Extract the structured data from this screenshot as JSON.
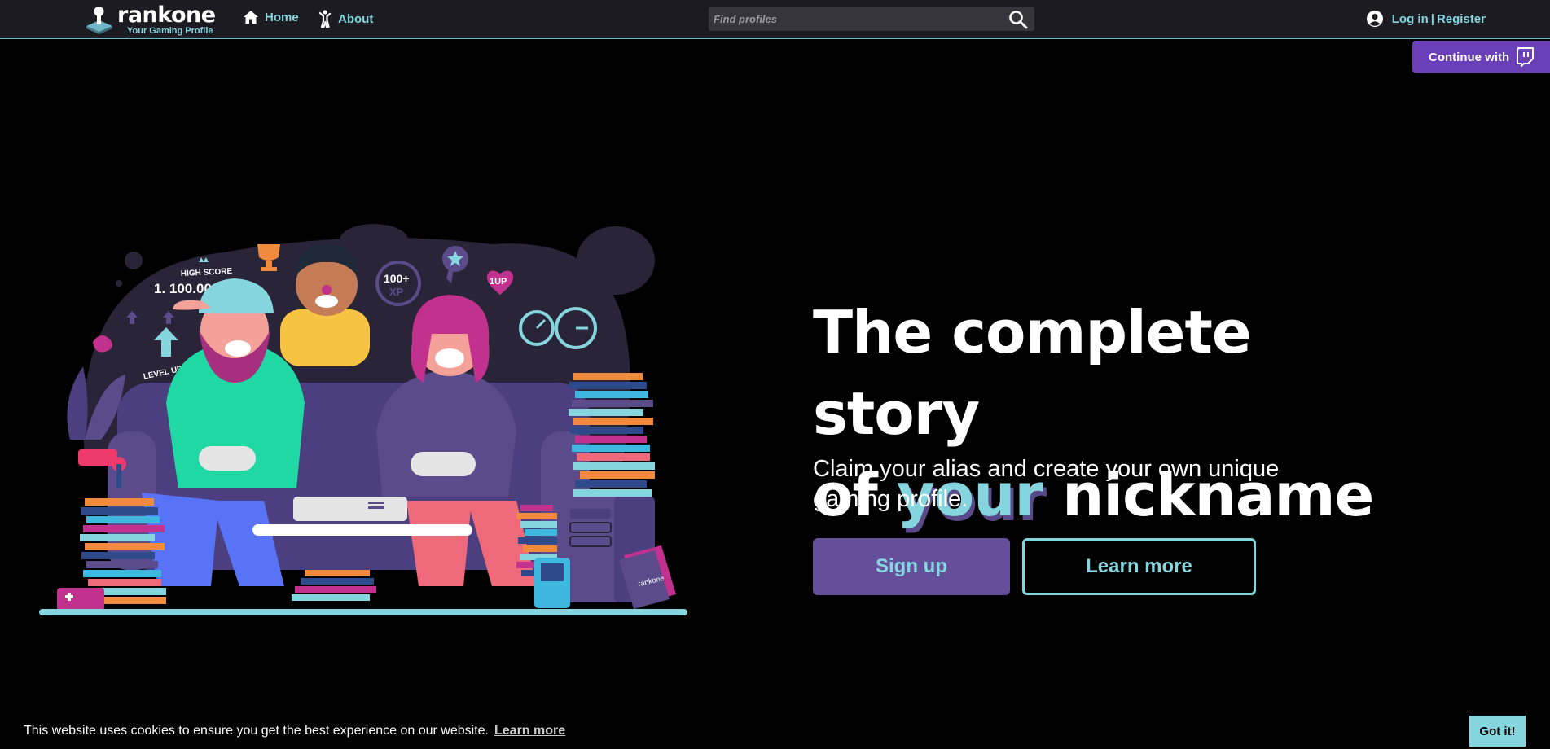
{
  "brand": {
    "name": "rankone",
    "tagline": "Your Gaming Profile"
  },
  "nav": {
    "home": "Home",
    "about": "About"
  },
  "search": {
    "placeholder": "Find profiles"
  },
  "auth": {
    "login": "Log in",
    "separator": "|",
    "register": "Register"
  },
  "twitch": {
    "label": "Continue with"
  },
  "hero": {
    "title_line1": "The complete story",
    "title_of": "of",
    "title_your": "your",
    "title_nickname": "nickname",
    "subtitle": "Claim your alias and create your own unique gaming profile.",
    "signup_label": "Sign up",
    "learn_more_label": "Learn more"
  },
  "illustration": {
    "high_score_label": "HIGH SCORE",
    "high_score_value": "1. 100.000.000",
    "xp_badge_top": "100+",
    "xp_badge_bottom": "XP",
    "oneup": "1UP",
    "level_up": "LEVEL UP",
    "book_text": "rankone"
  },
  "cookie": {
    "message": "This website uses cookies to ensure you get the best experience on our website.",
    "link": "Learn more",
    "button": "Got it!"
  },
  "colors": {
    "accent": "#84d5dd",
    "purple": "#654f9a",
    "twitch": "#6b3fb8",
    "navbar": "#1c1b22"
  }
}
